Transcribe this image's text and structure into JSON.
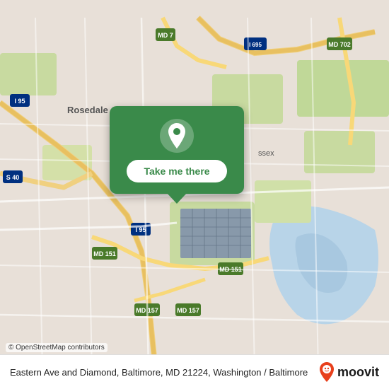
{
  "map": {
    "alt": "Map of Eastern Ave and Diamond, Baltimore, MD 21224",
    "bg_color": "#e8e0d8"
  },
  "popup": {
    "button_label": "Take me there",
    "bg_color": "#3a8a4a",
    "icon_symbol": "📍"
  },
  "bottom_bar": {
    "address": "Eastern Ave and Diamond, Baltimore, MD 21224,\nWashington / Baltimore",
    "logo_name": "moovit"
  },
  "osm_credit": "© OpenStreetMap contributors"
}
